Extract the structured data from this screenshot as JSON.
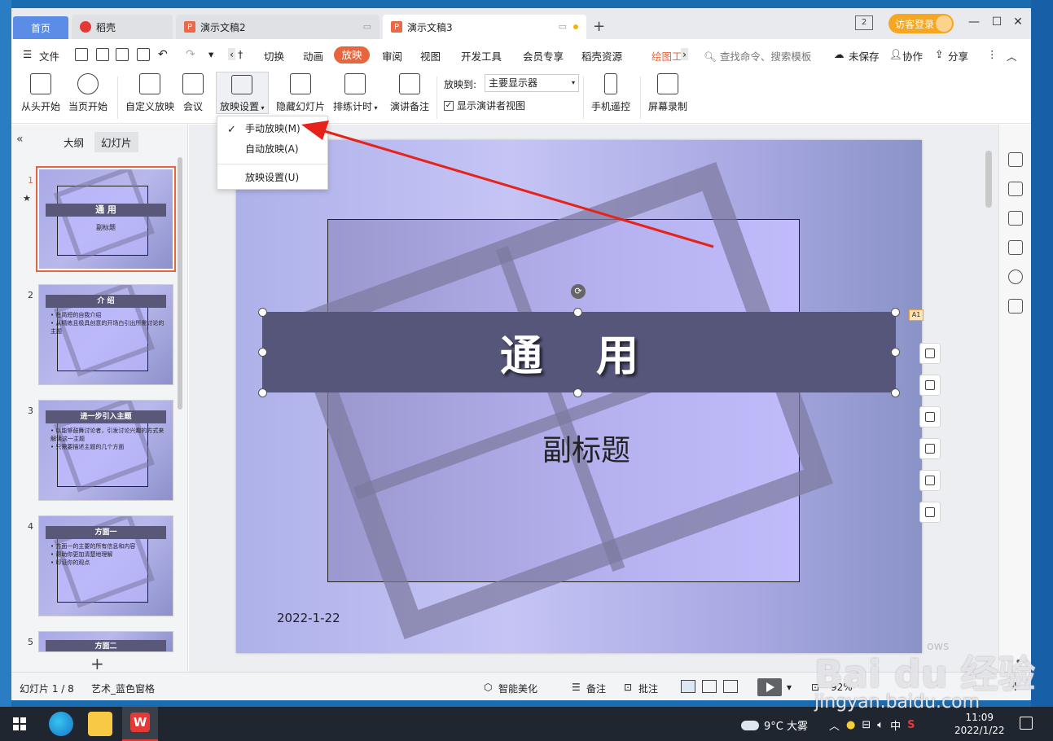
{
  "tabs": {
    "home": "首页",
    "daoke": "稻壳",
    "doc2": "演示文稿2",
    "doc3": "演示文稿3",
    "add": "+"
  },
  "titlebar": {
    "twin_label": "2",
    "login": "访客登录"
  },
  "menu": {
    "file": "文件",
    "items": [
      "切换",
      "动画",
      "放映",
      "审阅",
      "视图",
      "开发工具",
      "会员专享",
      "稻壳资源",
      "绘图工"
    ],
    "active": "放映",
    "search": "查找命令、搜索模板",
    "unsaved": "未保存",
    "collab": "协作",
    "share": "分享"
  },
  "ribbon": {
    "from_start": "从头开始",
    "from_current": "当页开始",
    "custom_show": "自定义放映",
    "meeting": "会议",
    "show_settings": "放映设置",
    "hide_slide": "隐藏幻灯片",
    "rehearse": "排练计时",
    "notes": "演讲备注",
    "show_to_label": "放映到:",
    "show_to_value": "主要显示器",
    "presenter_view": "显示演讲者视图",
    "phone_remote": "手机遥控",
    "screen_record": "屏幕录制"
  },
  "dropdown": {
    "items": [
      "手动放映(M)",
      "自动放映(A)",
      "放映设置(U)"
    ],
    "checked_index": 0
  },
  "leftpane": {
    "outline": "大纲",
    "slides": "幻灯片",
    "thumbs": [
      {
        "num": "1",
        "title": "通 用",
        "sub": "副标题"
      },
      {
        "num": "2",
        "title": "介 绍",
        "bullets": [
          "• 在简短的自我介绍",
          "• 从精练且极具创意的开场白引出所需讨论的主题"
        ]
      },
      {
        "num": "3",
        "title": "进一步引入主题",
        "bullets": [
          "• 以能够鼓舞讨论者，引发讨论兴趣的方式来解读这一主题",
          "• 只需要描述主题的几个方面"
        ]
      },
      {
        "num": "4",
        "title": "方面一",
        "bullets": [
          "• 方面一的主要的所有信息和内容",
          "• 帮助你更加清楚地理解",
          "• 印证你的观点"
        ]
      },
      {
        "num": "5",
        "title": "方面二"
      }
    ]
  },
  "slide": {
    "title": "通 用",
    "subtitle": "副标题",
    "date": "2022-1-22",
    "badge": "A1"
  },
  "statusbar": {
    "slide_count": "幻灯片 1 / 8",
    "theme": "艺术_蓝色窗格",
    "beautify": "智能美化",
    "notes": "备注",
    "comments": "批注",
    "zoom": "92%"
  },
  "watermark": {
    "main": "Bai du 经验",
    "url": "jingyan.baidu.com",
    "os_text": "ows"
  },
  "taskbar": {
    "weather": "9°C 大雾",
    "ime": "中",
    "time": "11:09",
    "date": "2022/1/22"
  },
  "colors": {
    "accent": "#e8663d",
    "tab_home": "#5b8de6",
    "title_bar": "#56557a",
    "arrow": "#e5231b"
  }
}
